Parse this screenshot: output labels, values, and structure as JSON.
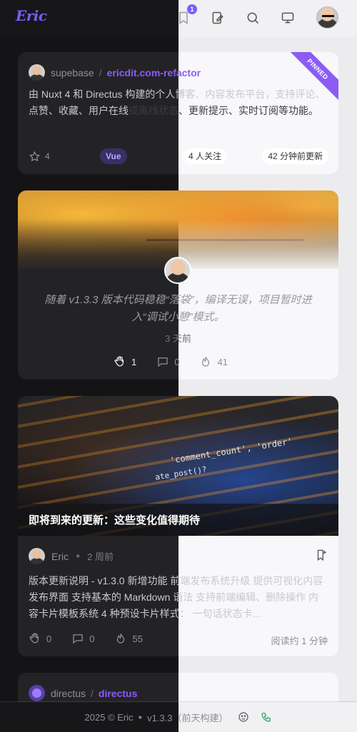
{
  "header": {
    "logo_text": "Eric",
    "notification_count": "1",
    "accent": "#7c5cff"
  },
  "repo_card": {
    "owner": "supebase",
    "separator": "/",
    "name": "ericdit.com-refactor",
    "pinned_label": "PINNED",
    "description_part1": "由 Nuxt 4 和 Directus 构建的个人博客、内容发布平台，支持评论、点赞、收藏、用户在线",
    "description_part2": "或离线状态、更新提示、实时订阅等功能。",
    "stars": "4",
    "language": "Vue",
    "followers": "4 人关注",
    "updated": "42 分钟前更新"
  },
  "moment_card": {
    "text": "随着 v1.3.3 版本代码稳稳“落袋”，编译无误，项目暂时进入“调试小憩”模式。",
    "time": "3 天前",
    "claps": "1",
    "comments": "0",
    "views": "41"
  },
  "post_card": {
    "cover_title": "即将到来的更新：这些变化值得期待",
    "cover_code_1": "'comment_count', 'order'",
    "cover_code_2": "ate_post()?",
    "cover_code_3": "",
    "author": "Eric",
    "time": "2 周前",
    "excerpt": "版本更新说明 - v1.3.0 新增功能 前端发布系统升级 提供可视化内容发布界面 支持基本的 Markdown 语法 支持前端编辑、删除操作 内容卡片模板系统 4 种预设卡片样式： 一句话状态卡…",
    "claps": "0",
    "comments": "0",
    "views": "55",
    "read_time": "阅读约 1 分钟"
  },
  "repo_card_2": {
    "owner": "directus",
    "separator": "/",
    "name": "directus"
  },
  "footer": {
    "copyright": "2025 © Eric",
    "version": "v1.3.3（前天构建）"
  },
  "icons": {
    "notifications": "bookmark-bell-icon",
    "publish": "edit-note-icon",
    "search": "search-icon",
    "theme": "display-icon"
  }
}
